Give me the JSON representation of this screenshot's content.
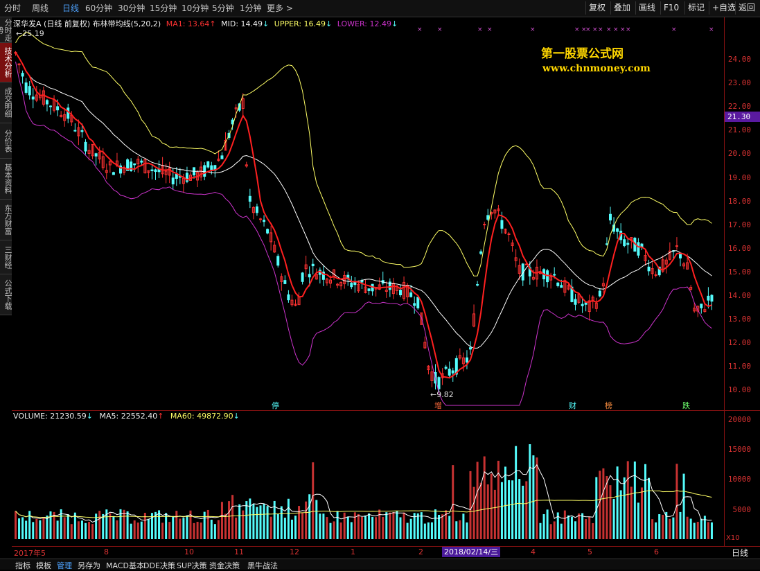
{
  "toolbar": {
    "timeframes": [
      "分时",
      "周线",
      "日线",
      "60分钟",
      "30分钟",
      "15分钟",
      "10分钟",
      "5分钟",
      "1分钟",
      "更多 >"
    ],
    "active": "日线",
    "right_buttons": [
      "复权",
      "叠加",
      "画线",
      "F10",
      "标记",
      "+自选",
      "返回"
    ]
  },
  "side_tabs": [
    "分时走势",
    "技术分析",
    "成交明细",
    "分价表",
    "基本资料",
    "东方财富",
    "三财经",
    "公式下载"
  ],
  "side_active": "技术分析",
  "main": {
    "stock": "深华发A",
    "mode": "(日线 前复权)",
    "indicator": "布林带均线(5,20,2)",
    "ma1": "MA1: 13.64",
    "mid": "MID: 14.49",
    "upper": "UPPER: 16.49",
    "lower": "LOWER: 12.49",
    "high_label": "25.19",
    "low_label": "9.82",
    "price_tag": "21.30",
    "watermark_cn": "第一股票公式网",
    "watermark_url": "www.chnmoney.com",
    "events": [
      "停",
      "增",
      "财",
      "榜",
      "跌"
    ],
    "y_ticks": [
      "24.00",
      "23.00",
      "22.00",
      "21.00",
      "20.00",
      "19.00",
      "18.00",
      "17.00",
      "16.00",
      "15.00",
      "14.00",
      "13.00",
      "12.00",
      "11.00",
      "10.00"
    ]
  },
  "volume": {
    "volume": "VOLUME: 21230.59",
    "ma5": "MA5: 22552.40",
    "ma60": "MA60: 49872.90",
    "y_ticks": [
      "20000",
      "15000",
      "10000",
      "5000"
    ],
    "unit": "X10"
  },
  "x_axis": {
    "labels": [
      "2017年5",
      "8",
      "10",
      "11",
      "12",
      "1",
      "2",
      "4",
      "5",
      "6"
    ],
    "cursor_date": "2018/02/14/三",
    "period": "日线"
  },
  "bottom_tabs": [
    "指标",
    "模板",
    "管理",
    "另存为",
    "MACD基本",
    "DDE决策",
    "SUP决策",
    "资金决策",
    "黑牛战法"
  ],
  "bottom_active": "管理",
  "colors": {
    "up": "#ff3232",
    "down": "#54fcfc",
    "ma": "#ff2020",
    "mid": "#ffffff",
    "upper": "#ffff66",
    "lower": "#cc33cc",
    "axis": "#8a1212"
  }
}
